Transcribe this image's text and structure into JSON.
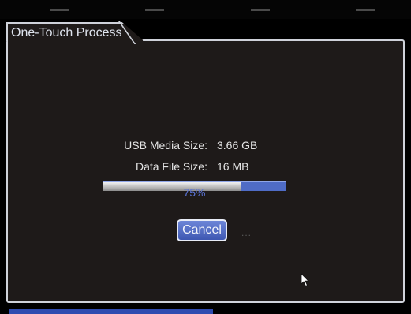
{
  "window": {
    "title": "One-Touch Process"
  },
  "info": {
    "usb_media_size_label": "USB Media Size:",
    "usb_media_size_value": "3.66 GB",
    "data_file_size_label": "Data File Size:",
    "data_file_size_value": "16 MB"
  },
  "progress": {
    "percent": 75,
    "label": "75%"
  },
  "buttons": {
    "cancel_label": "Cancel"
  },
  "indicator": {
    "dots": "..."
  },
  "colors": {
    "background": "#000000",
    "panel": "#1e1a19",
    "border": "#cfd2da",
    "accent_blue": "#4f6cc6",
    "progress_fill": "#cfcfcf",
    "progress_text": "#5a74d6"
  },
  "icons": {
    "cursor": "mouse-pointer-icon"
  }
}
